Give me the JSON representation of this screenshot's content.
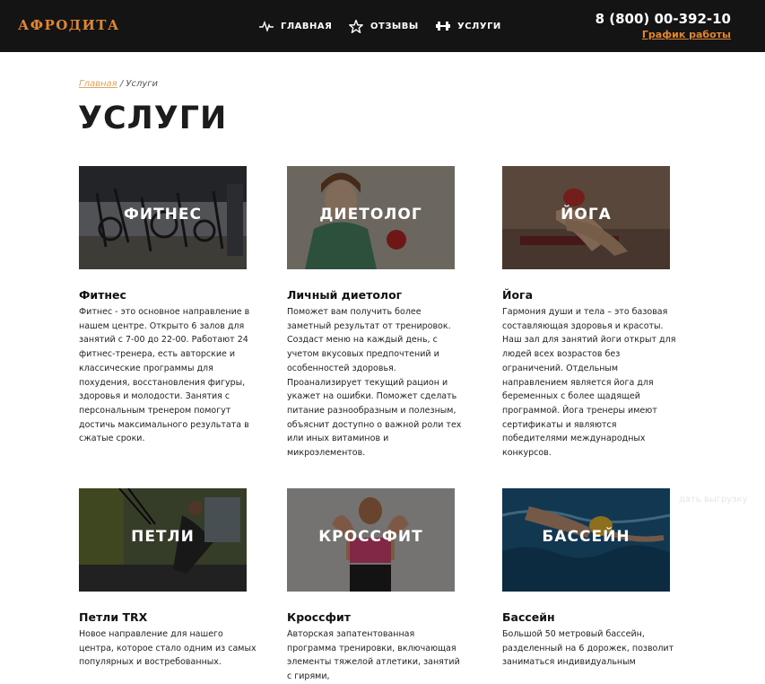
{
  "header": {
    "logo": "АФРОДИТА",
    "nav": [
      {
        "label": "ГЛАВНАЯ",
        "icon": "pulse-icon"
      },
      {
        "label": "ОТЗЫВЫ",
        "icon": "star-icon"
      },
      {
        "label": "УСЛУГИ",
        "icon": "dumbbell-icon"
      }
    ],
    "phone": "8 (800) 00-392-10",
    "schedule_link": "График работы"
  },
  "breadcrumb": {
    "home": "Главная",
    "separator": " / ",
    "current": "Услуги"
  },
  "page_title": "УСЛУГИ",
  "services": [
    {
      "image_label": "ФИТНЕС",
      "title": "Фитнес",
      "description": "Фитнес - это основное направление в нашем центре. Открыто 6 залов для занятий с 7-00 до 22-00. Работают 24 фитнес-тренера, есть авторские и классические программы для похудения, восстановления фигуры, здоровья и молодости. Занятия с персональным тренером помогут достичь максимального результата в сжатые сроки."
    },
    {
      "image_label": "ДИЕТОЛОГ",
      "title": "Личный диетолог",
      "description": "Поможет вам получить более заметный результат от тренировок. Создаст меню на каждый день, с учетом вкусовых предпочтений и особенностей здоровья. Проанализирует текущий рацион и укажет на ошибки. Поможет сделать питание разнообразным и полезным, объяснит доступно о важной роли тех или иных витаминов и микроэлементов."
    },
    {
      "image_label": "ЙОГА",
      "title": "Йога",
      "description": "Гармония души и тела – это базовая составляющая здоровья и красоты. Наш зал для занятий йоги открыт для людей всех возрастов без ограничений. Отдельным направлением является йога для беременных с более щадящей программой. Йога тренеры имеют сертификаты и являются победителями международных конкурсов."
    },
    {
      "image_label": "ПЕТЛИ",
      "title": "Петли TRX",
      "description": "Новое направление для нашего центра, которое стало одним из самых популярных и востребованных."
    },
    {
      "image_label": "КРОССФИТ",
      "title": "Кроссфит",
      "description": "Авторская запатентованная программа тренировки, включающая элементы тяжелой атлетики, занятий с гирями,"
    },
    {
      "image_label": "БАССЕЙН",
      "title": "Бассейн",
      "description": "Большой 50 метровый бассейн, разделенный на 6 дорожек, позволит заниматься индивидуальным"
    }
  ],
  "watermark": "дать выгрузку",
  "colors": {
    "accent": "#e2862f",
    "header_bg": "#141414",
    "text": "#222222"
  }
}
